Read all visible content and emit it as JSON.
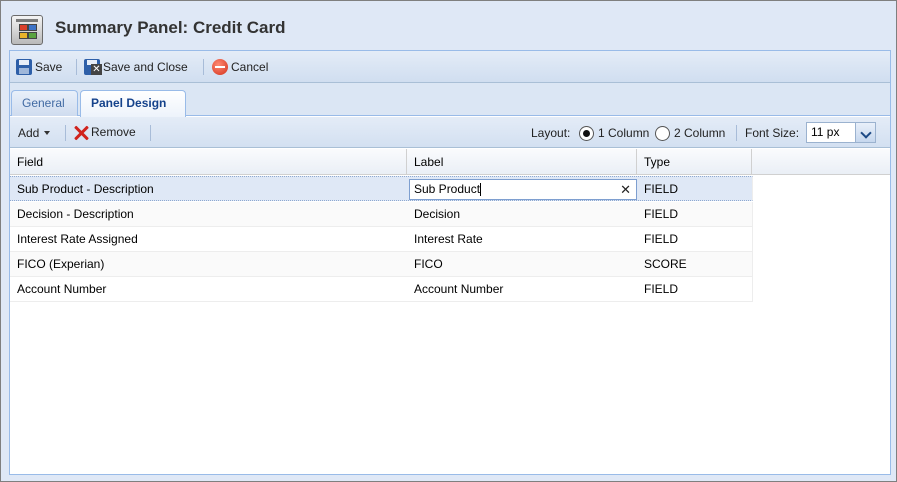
{
  "window": {
    "title": "Summary Panel: Credit Card"
  },
  "toolbar": {
    "save": "Save",
    "save_close": "Save and Close",
    "cancel": "Cancel"
  },
  "tabs": [
    {
      "label": "General"
    },
    {
      "label": "Panel Design"
    }
  ],
  "subbar": {
    "add": "Add",
    "remove": "Remove",
    "layout_label": "Layout:",
    "layout_options": [
      "1 Column",
      "2 Column"
    ],
    "layout_selected": "1 Column",
    "font_size_label": "Font Size:",
    "font_size_value": "11 px"
  },
  "grid": {
    "columns": [
      "Field",
      "Label",
      "Type"
    ],
    "rows": [
      {
        "field": "Sub Product - Description",
        "label": "Sub Product",
        "type": "FIELD"
      },
      {
        "field": "Decision - Description",
        "label": "Decision",
        "type": "FIELD"
      },
      {
        "field": "Interest Rate Assigned",
        "label": "Interest Rate",
        "type": "FIELD"
      },
      {
        "field": "FICO (Experian)",
        "label": "FICO",
        "type": "SCORE"
      },
      {
        "field": "Account Number",
        "label": "Account Number",
        "type": "FIELD"
      }
    ]
  }
}
